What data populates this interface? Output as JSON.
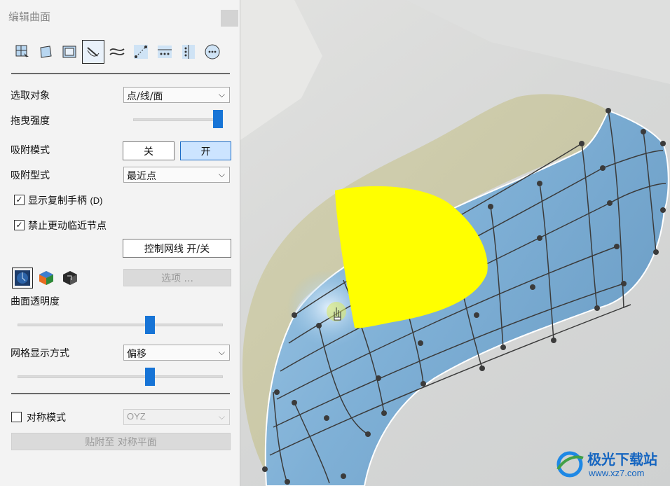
{
  "panel": {
    "title": "编辑曲面",
    "toolbar": [
      {
        "icon": "select-region-icon"
      },
      {
        "icon": "freeform-shape-icon"
      },
      {
        "icon": "rectangle-frame-icon"
      },
      {
        "icon": "line-curve-icon",
        "active": true
      },
      {
        "icon": "wave-curves-icon"
      },
      {
        "icon": "point-link-icon"
      },
      {
        "icon": "dotted-row-icon"
      },
      {
        "icon": "dotted-column-icon"
      },
      {
        "icon": "dots-circle-icon"
      }
    ],
    "select_object": {
      "label": "选取对象",
      "value": "点/线/面"
    },
    "drag_strength": {
      "label": "拖曳强度",
      "level": 1.0
    },
    "snap_mode": {
      "label": "吸附模式",
      "off_label": "关",
      "on_label": "开",
      "selected": "on"
    },
    "snap_type": {
      "label": "吸附型式",
      "value": "最近点"
    },
    "show_copy_handle": {
      "label": "显示复制手柄",
      "shortcut": "(D)",
      "checked": true
    },
    "prevent_neighbor": {
      "label": "禁止更动临近节点",
      "checked": true
    },
    "control_mesh_button": "控制网线 开/关",
    "options_button": "选项 ...",
    "surface_transparency": {
      "label": "曲面透明度",
      "level": 0.6
    },
    "mesh_display": {
      "label": "网格显示方式",
      "value": "偏移",
      "level": 0.6
    },
    "symmetry": {
      "label": "对称模式",
      "checked": false,
      "plane": "OYZ"
    },
    "snap_to_plane_button": "贴附至 对称平面"
  },
  "watermark": {
    "brand": "极光下载站",
    "url": "www.xz7.com"
  },
  "colors": {
    "accent": "#1774d6",
    "surface_blue": "#7fb0d6",
    "surface_beige": "#d6d4b8",
    "highlight_yellow": "#ffff00"
  }
}
